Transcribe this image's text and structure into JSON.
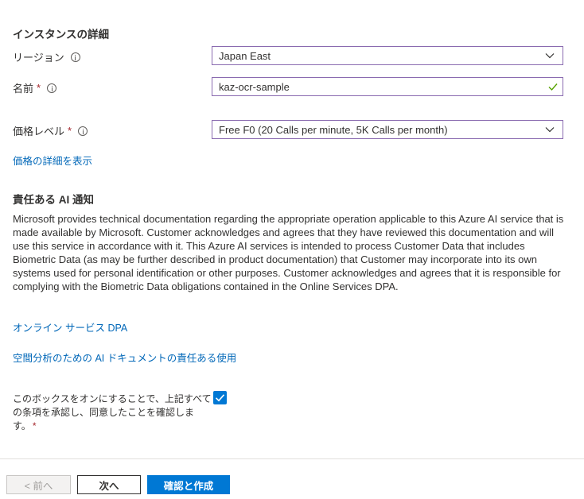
{
  "instance": {
    "title": "インスタンスの詳細",
    "region_label": "リージョン",
    "region_value": "Japan East",
    "name_label": "名前",
    "name_value": "kaz-ocr-sample",
    "required_mark": "*",
    "pricing_label": "価格レベル",
    "pricing_value": "Free F0 (20 Calls per minute, 5K Calls per month)",
    "pricing_link": "価格の詳細を表示"
  },
  "responsible_ai": {
    "title": "責任ある AI 通知",
    "notice": "Microsoft provides technical documentation regarding the appropriate operation applicable to this Azure AI service that is made available by Microsoft. Customer acknowledges and agrees that they have reviewed this documentation and will use this service in accordance with it. This Azure AI services is intended to process Customer Data that includes Biometric Data (as may be further described in product documentation) that Customer may incorporate into its own systems used for personal identification or other purposes. Customer acknowledges and agrees that it is responsible for complying with the Biometric Data obligations contained in the Online Services DPA.",
    "link_dpa": "オンライン サービス DPA",
    "link_doc": "空間分析のための AI ドキュメントの責任ある使用",
    "consent_text": "このボックスをオンにすることで、上記すべての条項を承認し、同意したことを確認します。",
    "consent_checked": true
  },
  "footer": {
    "prev_label": "< 前へ",
    "next_label": "次へ",
    "create_label": "確認と作成"
  },
  "colors": {
    "accent": "#0078d4",
    "link": "#0067b8",
    "field_border": "#8a6bb0",
    "required": "#a4262c",
    "valid_check": "#57a300"
  }
}
